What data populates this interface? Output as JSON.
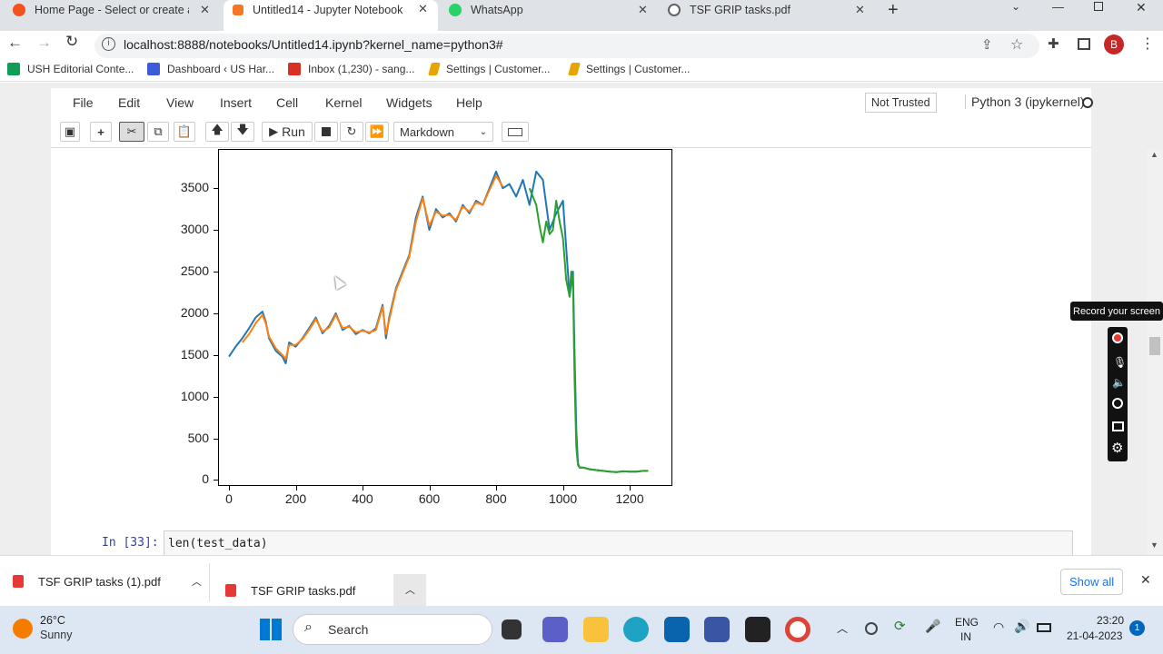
{
  "browser": {
    "tabs": [
      {
        "title": "Home Page - Select or create a n",
        "icon_color": "#f4511e"
      },
      {
        "title": "Untitled14 - Jupyter Notebook",
        "icon_color": "#f37726"
      },
      {
        "title": "WhatsApp",
        "icon_color": "#25d366"
      },
      {
        "title": "TSF GRIP tasks.pdf",
        "icon_color": "#5f6368"
      }
    ],
    "url": "localhost:8888/notebooks/Untitled14.ipynb?kernel_name=python3#",
    "profile_initial": "B",
    "bookmarks": [
      {
        "label": "USH Editorial Conte...",
        "icon_color": "#0f9d58"
      },
      {
        "label": "Dashboard ‹ US Har...",
        "icon_color": "#3b5bdb"
      },
      {
        "label": "Inbox (1,230) - sang...",
        "icon_color": "#d93025"
      },
      {
        "label": "Settings | Customer...",
        "icon_color": "#e8a400"
      },
      {
        "label": "Settings | Customer...",
        "icon_color": "#e8a400"
      }
    ]
  },
  "jupyter": {
    "menu": [
      "File",
      "Edit",
      "View",
      "Insert",
      "Cell",
      "Kernel",
      "Widgets",
      "Help"
    ],
    "trust_label": "Not Trusted",
    "kernel_label": "Python 3 (ipykernel)",
    "run_label": "Run",
    "cell_type": "Markdown",
    "next_cell_prompt": "In [33]:",
    "next_cell_code": "len(test_data)"
  },
  "chart_data": {
    "type": "line",
    "title": "",
    "xlabel": "",
    "ylabel": "",
    "xlim": [
      -30,
      1325
    ],
    "ylim": [
      -60,
      3960
    ],
    "xticks": [
      0,
      200,
      400,
      600,
      800,
      1000,
      1200
    ],
    "yticks": [
      0,
      500,
      1000,
      1500,
      2000,
      2500,
      3000,
      3500
    ],
    "grid": false,
    "series": [
      {
        "color": "#1f77b4",
        "x": [
          0,
          20,
          40,
          60,
          80,
          100,
          110,
          120,
          140,
          160,
          170,
          180,
          200,
          220,
          240,
          260,
          280,
          300,
          320,
          340,
          360,
          380,
          400,
          420,
          440,
          460,
          470,
          480,
          500,
          520,
          540,
          560,
          580,
          600,
          620,
          640,
          660,
          680,
          700,
          720,
          740,
          760,
          780,
          800,
          820,
          840,
          860,
          880,
          900,
          920,
          940,
          960,
          980,
          1000,
          1020,
          1030,
          1035,
          1040,
          1045,
          1050,
          1060,
          1080,
          1100,
          1120,
          1140,
          1160,
          1180,
          1200,
          1220,
          1240,
          1255
        ],
        "y": [
          1480,
          1600,
          1700,
          1820,
          1950,
          2020,
          1900,
          1700,
          1550,
          1480,
          1400,
          1650,
          1600,
          1700,
          1820,
          1950,
          1760,
          1850,
          2000,
          1800,
          1850,
          1750,
          1800,
          1760,
          1820,
          2100,
          1700,
          1950,
          2300,
          2500,
          2700,
          3150,
          3400,
          3000,
          3250,
          3150,
          3200,
          3100,
          3300,
          3200,
          3350,
          3300,
          3500,
          3700,
          3500,
          3550,
          3400,
          3600,
          3300,
          3700,
          3600,
          3000,
          3200,
          3350,
          2200,
          2500,
          1500,
          600,
          200,
          150,
          150,
          130,
          120,
          110,
          100,
          95,
          105,
          100,
          100,
          110,
          110
        ]
      },
      {
        "color": "#ff7f0e",
        "x": [
          40,
          60,
          80,
          100,
          110,
          120,
          140,
          160,
          170,
          180,
          200,
          220,
          240,
          260,
          280,
          300,
          320,
          340,
          360,
          380,
          400,
          420,
          440,
          460,
          470,
          480,
          500,
          520,
          540,
          560,
          580,
          600,
          620,
          640,
          660,
          680,
          700,
          720,
          740,
          760,
          780,
          800,
          820
        ],
        "y": [
          1650,
          1750,
          1880,
          1980,
          1880,
          1720,
          1580,
          1500,
          1450,
          1620,
          1620,
          1690,
          1800,
          1930,
          1780,
          1830,
          1980,
          1820,
          1840,
          1770,
          1790,
          1770,
          1800,
          2080,
          1750,
          1920,
          2280,
          2480,
          2680,
          3100,
          3380,
          3050,
          3220,
          3170,
          3180,
          3120,
          3280,
          3220,
          3330,
          3300,
          3480,
          3650,
          3520
        ]
      },
      {
        "color": "#2ca02c",
        "x": [
          900,
          920,
          930,
          940,
          950,
          960,
          970,
          980,
          990,
          1000,
          1010,
          1020,
          1025,
          1030,
          1035,
          1040,
          1045,
          1050,
          1060,
          1080,
          1100,
          1120,
          1140,
          1160,
          1180,
          1200,
          1220,
          1240,
          1255
        ],
        "y": [
          3500,
          3300,
          3050,
          2850,
          3100,
          2950,
          3000,
          3350,
          3100,
          2900,
          2400,
          2200,
          2500,
          2400,
          1200,
          400,
          180,
          150,
          150,
          130,
          120,
          110,
          100,
          95,
          105,
          100,
          100,
          110,
          110
        ]
      }
    ]
  },
  "downloads": [
    {
      "name": "TSF GRIP tasks (1).pdf"
    },
    {
      "name": "TSF GRIP tasks.pdf"
    }
  ],
  "show_all_label": "Show all",
  "recorder": {
    "tooltip": "Record your screen"
  },
  "weather": {
    "temp": "26°C",
    "condition": "Sunny"
  },
  "taskbar": {
    "search_label": "Search",
    "lang1": "ENG",
    "lang2": "IN",
    "time": "23:20",
    "date": "21-04-2023",
    "notif_count": "1"
  }
}
